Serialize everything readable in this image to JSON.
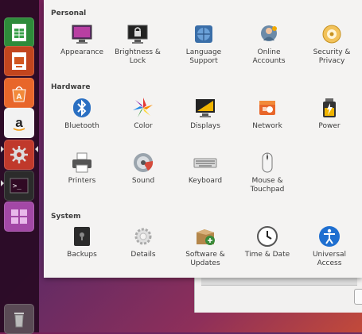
{
  "settings": {
    "sections": [
      {
        "title": "Personal",
        "items": [
          {
            "label": "Appearance",
            "icon": "appearance-icon"
          },
          {
            "label": "Brightness &\nLock",
            "icon": "brightness-lock-icon"
          },
          {
            "label": "Language\nSupport",
            "icon": "language-support-icon"
          },
          {
            "label": "Online\nAccounts",
            "icon": "online-accounts-icon"
          },
          {
            "label": "Security &\nPrivacy",
            "icon": "security-privacy-icon"
          }
        ]
      },
      {
        "title": "Hardware",
        "items": [
          {
            "label": "Bluetooth",
            "icon": "bluetooth-icon"
          },
          {
            "label": "Color",
            "icon": "color-icon"
          },
          {
            "label": "Displays",
            "icon": "displays-icon"
          },
          {
            "label": "Network",
            "icon": "network-icon"
          },
          {
            "label": "Power",
            "icon": "power-icon"
          },
          {
            "label": "Printers",
            "icon": "printers-icon"
          },
          {
            "label": "Sound",
            "icon": "sound-icon"
          },
          {
            "label": "Keyboard",
            "icon": "keyboard-icon"
          },
          {
            "label": "Mouse &\nTouchpad",
            "icon": "mouse-touchpad-icon"
          }
        ]
      },
      {
        "title": "System",
        "items": [
          {
            "label": "Backups",
            "icon": "backups-icon"
          },
          {
            "label": "Details",
            "icon": "details-icon"
          },
          {
            "label": "Software &\nUpdates",
            "icon": "software-updates-icon"
          },
          {
            "label": "Time & Date",
            "icon": "time-date-icon"
          },
          {
            "label": "Universal\nAccess",
            "icon": "universal-access-icon"
          }
        ]
      }
    ]
  },
  "launcher": {
    "items": [
      {
        "name": "libreoffice-calc-icon"
      },
      {
        "name": "libreoffice-impress-icon"
      },
      {
        "name": "software-center-icon"
      },
      {
        "name": "amazon-icon"
      },
      {
        "name": "system-settings-icon"
      },
      {
        "name": "terminal-icon"
      },
      {
        "name": "workspace-switcher-icon"
      },
      {
        "name": "trash-icon"
      }
    ]
  }
}
